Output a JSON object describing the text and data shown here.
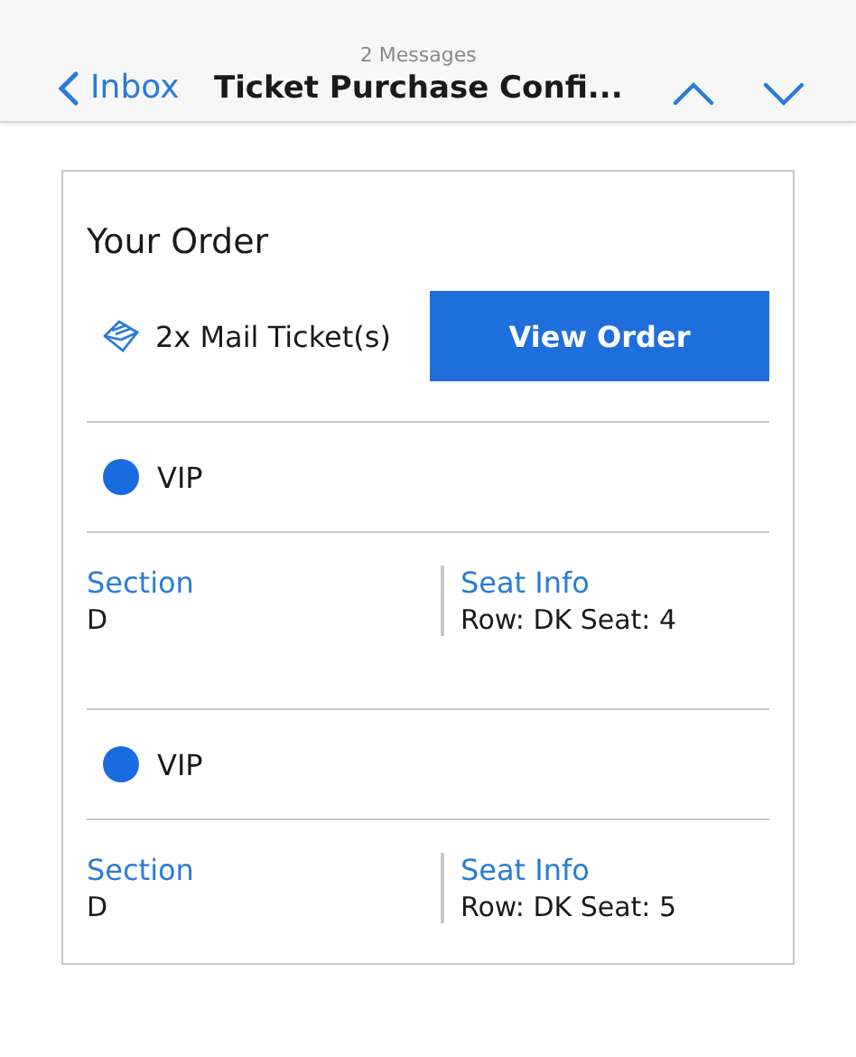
{
  "nav": {
    "back_label": "Inbox",
    "message_count": "2 Messages",
    "subject": "Ticket Purchase Confi..."
  },
  "order": {
    "title": "Your Order",
    "delivery": "2x Mail Ticket(s)",
    "button": "View Order",
    "tickets": [
      {
        "type": "VIP",
        "color": "#1a6be0",
        "section_label": "Section",
        "section": "D",
        "seat_label": "Seat Info",
        "seat": "Row: DK Seat: 4"
      },
      {
        "type": "VIP",
        "color": "#1a6be0",
        "section_label": "Section",
        "section": "D",
        "seat_label": "Seat Info",
        "seat": "Row: DK Seat: 5"
      }
    ]
  }
}
